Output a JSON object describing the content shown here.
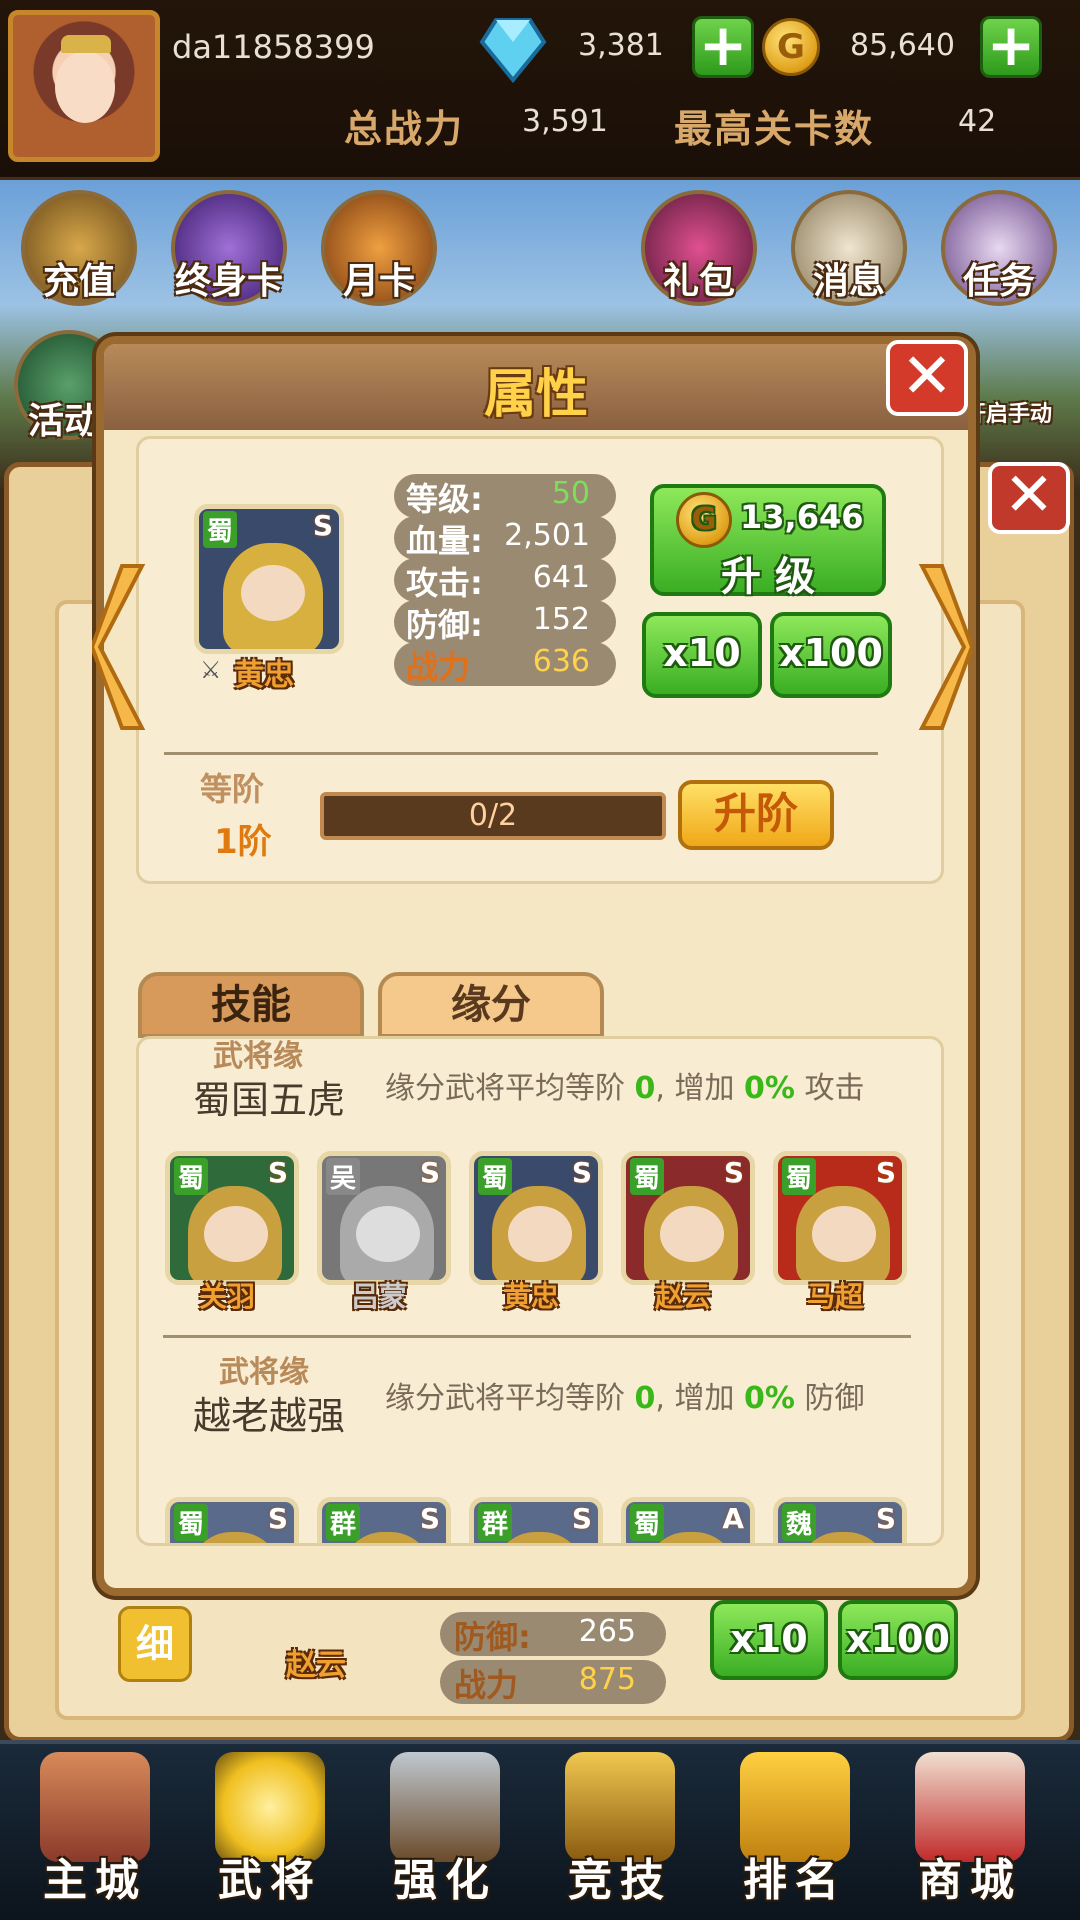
{
  "topbar": {
    "username": "da11858399",
    "gems": "3,381",
    "gold": "85,640",
    "total_power_label": "总战力",
    "total_power": "3,591",
    "max_stage_label": "最高关卡数",
    "max_stage": "42",
    "coin_glyph": "G"
  },
  "menu": {
    "items": [
      {
        "label": "充值",
        "icon": "money-bag-icon"
      },
      {
        "label": "终身卡",
        "icon": "lifetime-card-icon"
      },
      {
        "label": "月卡",
        "icon": "monthly-card-icon"
      },
      {
        "label": "礼包",
        "icon": "gift-icon"
      },
      {
        "label": "消息",
        "icon": "letter-icon"
      },
      {
        "label": "任务",
        "icon": "scroll-icon"
      }
    ],
    "second_row_label": "活动",
    "auto_label": "开启手动"
  },
  "modal": {
    "title": "属性",
    "hero": {
      "kingdom": "蜀",
      "grade": "S",
      "name": "黄忠"
    },
    "stats": [
      {
        "label": "等级:",
        "value": "50",
        "color": "#7dde5a"
      },
      {
        "label": "血量:",
        "value": "2,501",
        "color": "#ffffff"
      },
      {
        "label": "攻击:",
        "value": "641",
        "color": "#ffffff"
      },
      {
        "label": "防御:",
        "value": "152",
        "color": "#ffffff"
      },
      {
        "label": "战力",
        "value": "636",
        "color": "#ffd24a"
      }
    ],
    "upgrade_cost": "13,646",
    "upgrade_label": "升 级",
    "x10_label": "x10",
    "x100_label": "x100",
    "rank_label": "等阶",
    "rank_value": "1阶",
    "rank_progress": "0/2",
    "rank_progress_fraction": 0,
    "rank_up_label": "升阶",
    "tabs": [
      {
        "label": "技能",
        "active": false
      },
      {
        "label": "缘分",
        "active": true
      }
    ],
    "bonds": [
      {
        "title": "武将缘",
        "name": "蜀国五虎",
        "desc_prefix": "缘分武将平均等阶 ",
        "desc_value": "0",
        "desc_mid": ", 增加 ",
        "desc_pct": "0%",
        "desc_suffix": " 攻击",
        "heroes": [
          {
            "kingdom": "蜀",
            "grade": "S",
            "name": "关羽",
            "color": "#2e6a3a",
            "gray": false
          },
          {
            "kingdom": "吴",
            "grade": "S",
            "name": "吕蒙",
            "color": "#777777",
            "gray": true
          },
          {
            "kingdom": "蜀",
            "grade": "S",
            "name": "黄忠",
            "color": "#3a4a6a",
            "gray": false
          },
          {
            "kingdom": "蜀",
            "grade": "S",
            "name": "赵云",
            "color": "#8a2a2a",
            "gray": false
          },
          {
            "kingdom": "蜀",
            "grade": "S",
            "name": "马超",
            "color": "#b82a1a",
            "gray": false
          }
        ]
      },
      {
        "title": "武将缘",
        "name": "越老越强",
        "desc_prefix": "缘分武将平均等阶 ",
        "desc_value": "0",
        "desc_mid": ", 增加 ",
        "desc_pct": "0%",
        "desc_suffix": " 防御",
        "heroes": [
          {
            "kingdom": "蜀",
            "grade": "S"
          },
          {
            "kingdom": "群",
            "grade": "S"
          },
          {
            "kingdom": "群",
            "grade": "S"
          },
          {
            "kingdom": "蜀",
            "grade": "A"
          },
          {
            "kingdom": "魏",
            "grade": "S"
          }
        ]
      }
    ]
  },
  "background_card": {
    "detail_label": "细",
    "hero_name": "赵云",
    "defense_label": "防御:",
    "defense_value": "265",
    "power_label": "战力",
    "power_value": "875",
    "x10_label": "x10",
    "x100_label": "x100"
  },
  "bottom_nav": [
    {
      "label": "主城",
      "icon": "castle-icon"
    },
    {
      "label": "武将",
      "icon": "hero-icon"
    },
    {
      "label": "强化",
      "icon": "hammer-icon"
    },
    {
      "label": "竞技",
      "icon": "fist-icon"
    },
    {
      "label": "排名",
      "icon": "flag-icon"
    },
    {
      "label": "商城",
      "icon": "shop-icon"
    }
  ]
}
